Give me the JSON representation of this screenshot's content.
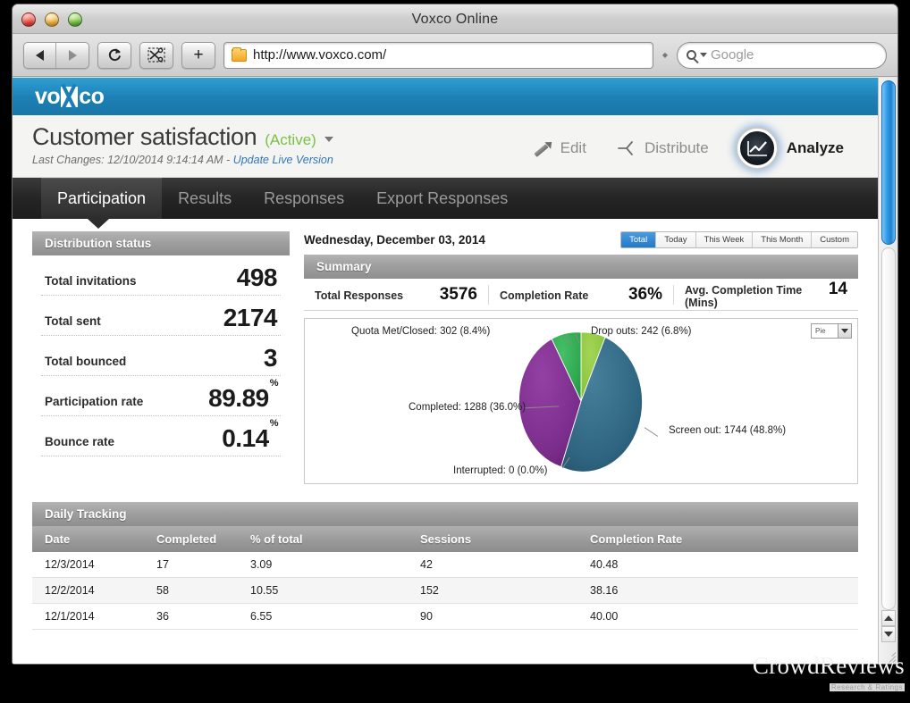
{
  "window": {
    "title": "Voxco Online",
    "traffic_lights": [
      "close",
      "minimize",
      "maximize"
    ]
  },
  "toolbar": {
    "back": "back-icon",
    "forward": "forward-icon",
    "reload": "reload-icon",
    "snip": "scissors-icon",
    "add": "+",
    "url": "http://www.voxco.com/",
    "search_placeholder": "Google"
  },
  "app": {
    "brand": {
      "pre": "vo",
      "post": "co"
    },
    "survey": {
      "title": "Customer satisfaction",
      "status": "(Active)",
      "last_changes_prefix": "Last Changes: 12/10/2014 9:14:14 AM - ",
      "update_link": "Update Live Version"
    },
    "actions": [
      {
        "label": "Edit",
        "icon": "pencil-icon",
        "active": false
      },
      {
        "label": "Distribute",
        "icon": "share-icon",
        "active": false
      },
      {
        "label": "Analyze",
        "icon": "chart-circle-icon",
        "active": true
      }
    ],
    "tabs": [
      {
        "label": "Participation",
        "active": true
      },
      {
        "label": "Results",
        "active": false
      },
      {
        "label": "Responses",
        "active": false
      },
      {
        "label": "Export Responses",
        "active": false
      }
    ]
  },
  "distribution": {
    "header": "Distribution status",
    "rows": [
      {
        "label": "Total invitations",
        "value": "498",
        "unit": ""
      },
      {
        "label": "Total sent",
        "value": "2174",
        "unit": ""
      },
      {
        "label": "Total bounced",
        "value": "3",
        "unit": ""
      },
      {
        "label": "Participation rate",
        "value": "89.89",
        "unit": "%"
      },
      {
        "label": "Bounce rate",
        "value": "0.14",
        "unit": "%"
      }
    ]
  },
  "summary": {
    "date": "Wednesday, December 03, 2014",
    "range_tabs": [
      {
        "label": "Total",
        "active": true
      },
      {
        "label": "Today",
        "active": false
      },
      {
        "label": "This Week",
        "active": false
      },
      {
        "label": "This Month",
        "active": false
      },
      {
        "label": "Custom",
        "active": false
      }
    ],
    "header": "Summary",
    "cells": [
      {
        "label": "Total Responses",
        "value": "3576"
      },
      {
        "label": "Completion Rate",
        "value": "36%"
      },
      {
        "label": "Avg. Completion Time (Mins)",
        "value": "14"
      }
    ],
    "chart_type_selected": "Pie"
  },
  "chart_data": {
    "type": "pie",
    "title": "",
    "legend": "labels-outside",
    "labels": [
      "Quota Met/Closed: 302 (8.4%)",
      "Drop outs: 242 (6.8%)",
      "Screen out: 1744 (48.8%)",
      "Interrupted: 0 (0.0%)",
      "Completed: 1288 (36.0%)"
    ],
    "slices": [
      {
        "name": "Drop outs",
        "value": 242,
        "percent": 6.8,
        "color": "#8CC63E"
      },
      {
        "name": "Screen out",
        "value": 1744,
        "percent": 48.8,
        "color": "#2F6580"
      },
      {
        "name": "Interrupted",
        "value": 0,
        "percent": 0.0,
        "color": "#2F6580"
      },
      {
        "name": "Completed",
        "value": 1288,
        "percent": 36.0,
        "color": "#7B2D8C"
      },
      {
        "name": "Quota Met/Closed",
        "value": 302,
        "percent": 8.4,
        "color": "#2FA84F"
      }
    ],
    "total": 3576
  },
  "daily": {
    "header": "Daily Tracking",
    "columns": [
      "Date",
      "Completed",
      "% of total",
      "Sessions",
      "Completion Rate"
    ],
    "rows": [
      {
        "date": "12/3/2014",
        "completed": "17",
        "pct": "3.09",
        "sessions": "42",
        "rate": "40.48"
      },
      {
        "date": "12/2/2014",
        "completed": "58",
        "pct": "10.55",
        "sessions": "152",
        "rate": "38.16"
      },
      {
        "date": "12/1/2014",
        "completed": "36",
        "pct": "6.55",
        "sessions": "90",
        "rate": "40.00"
      }
    ]
  },
  "watermark": {
    "main": "CrowdReviews",
    "sub": "Research & Ratings"
  },
  "colors": {
    "brand_blue": "#1c7fb4",
    "active_green": "#7ac143",
    "link_blue": "#2f76b8",
    "range_active": "#2279c9"
  }
}
